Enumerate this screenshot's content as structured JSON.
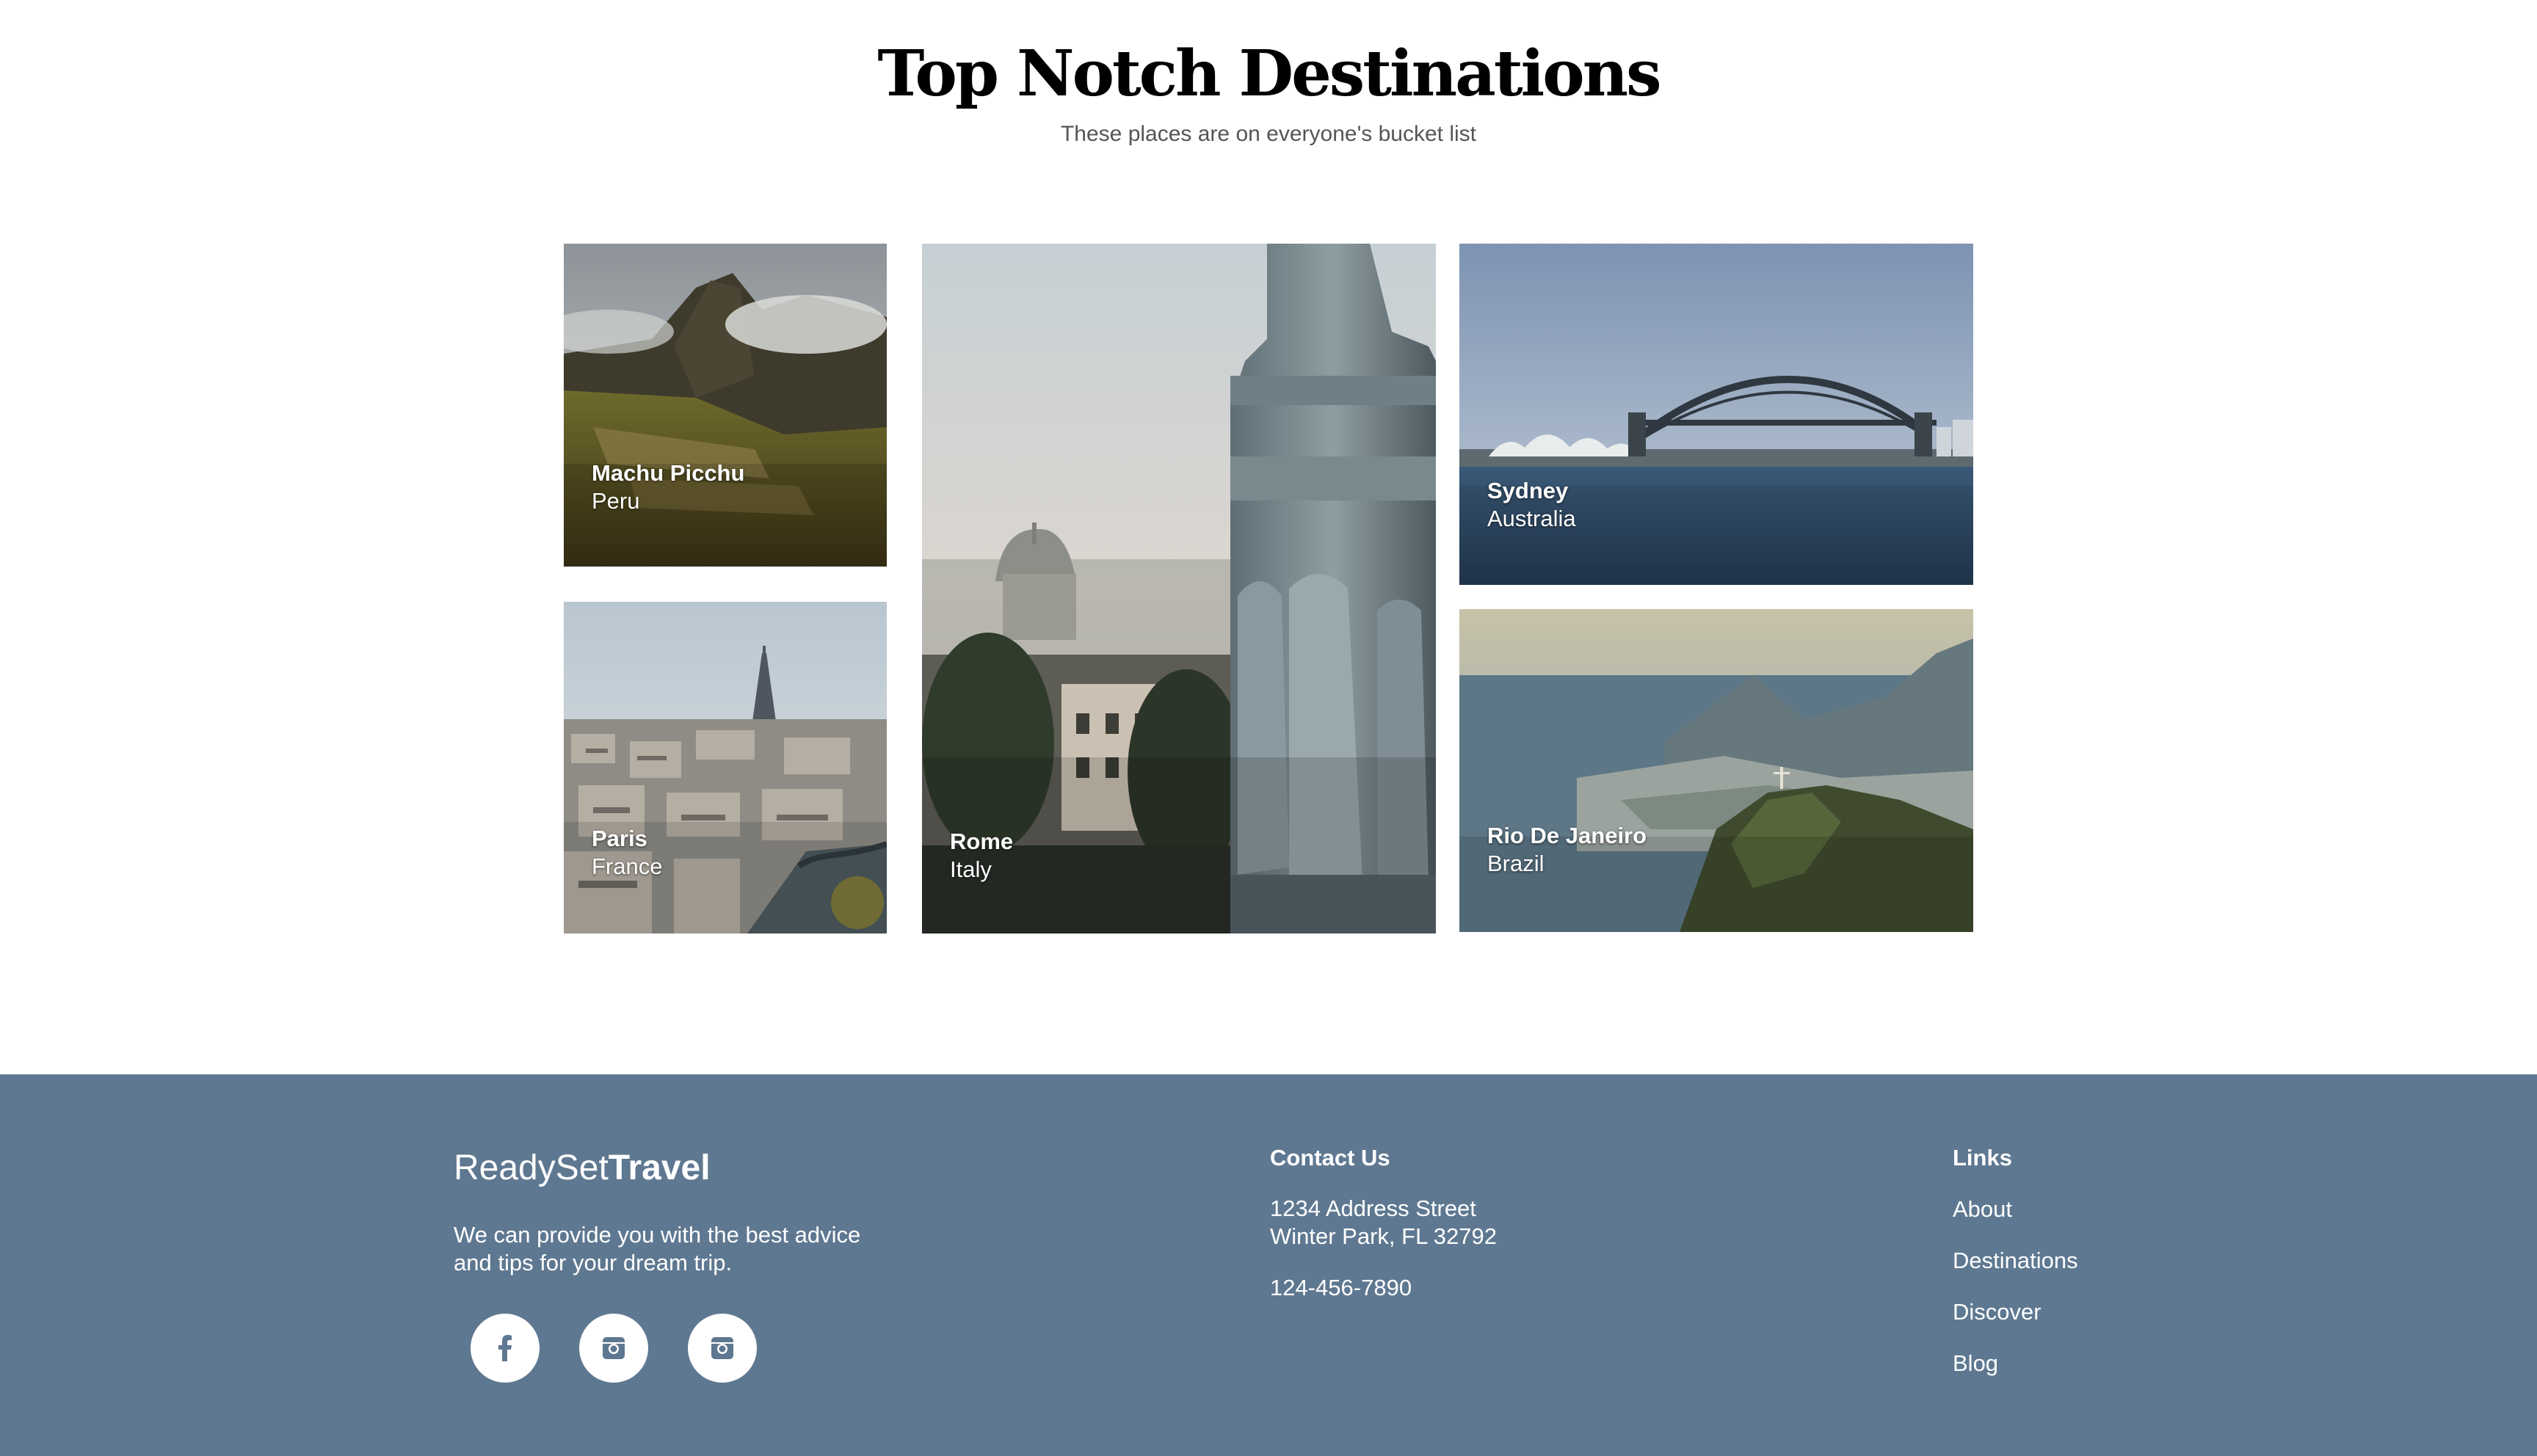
{
  "header": {
    "title": "Top Notch Destinations",
    "subtitle": "These places are on everyone's bucket list"
  },
  "destinations": [
    {
      "city": "Machu Picchu",
      "country": "Peru"
    },
    {
      "city": "Paris",
      "country": "France"
    },
    {
      "city": "Rome",
      "country": "Italy"
    },
    {
      "city": "Sydney",
      "country": "Australia"
    },
    {
      "city": "Rio De Janeiro",
      "country": "Brazil"
    }
  ],
  "footer": {
    "brand_light": "ReadySet",
    "brand_bold": "Travel",
    "tagline": "We can provide you with the best advice and tips for your dream trip.",
    "social": [
      "facebook-icon",
      "instagram-icon",
      "instagram-icon"
    ],
    "contact": {
      "heading": "Contact Us",
      "address_line1": "1234 Address Street",
      "address_line2": "Winter Park, FL 32792",
      "phone": "124-456-7890"
    },
    "links": {
      "heading": "Links",
      "items": [
        "About",
        "Destinations",
        "Discover",
        "Blog"
      ]
    }
  },
  "colors": {
    "footer_bg": "#5f7891",
    "text_on_footer": "#ffffff"
  }
}
